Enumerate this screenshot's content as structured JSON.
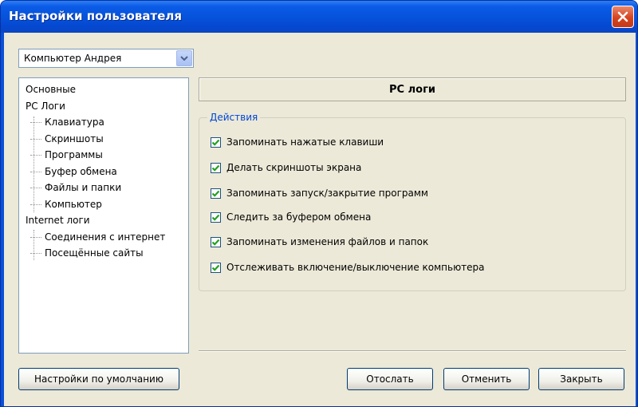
{
  "window": {
    "title": "Настройки пользователя"
  },
  "user_combo": {
    "value": "Компьютер Андрея"
  },
  "tree": {
    "items": [
      {
        "label": "Основные",
        "level": 0
      },
      {
        "label": "PC Логи",
        "level": 0
      },
      {
        "label": "Клавиатура",
        "level": 1
      },
      {
        "label": "Скриншоты",
        "level": 1
      },
      {
        "label": "Программы",
        "level": 1
      },
      {
        "label": "Буфер обмена",
        "level": 1
      },
      {
        "label": "Файлы и папки",
        "level": 1
      },
      {
        "label": "Компьютер",
        "level": 1
      },
      {
        "label": "Internet логи",
        "level": 0
      },
      {
        "label": "Соединения с интернет",
        "level": 1
      },
      {
        "label": "Посещённые сайты",
        "level": 1
      }
    ]
  },
  "panel": {
    "header": "PC логи",
    "group_title": "Действия",
    "checkboxes": [
      {
        "label": "Запоминать нажатые клавиши",
        "checked": true
      },
      {
        "label": "Делать скриншоты экрана",
        "checked": true
      },
      {
        "label": "Запоминать запуск/закрытие программ",
        "checked": true
      },
      {
        "label": "Следить за буфером обмена",
        "checked": true
      },
      {
        "label": "Запоминать изменения файлов и папок",
        "checked": true
      },
      {
        "label": "Отслеживать включение/выключение компьютера",
        "checked": true
      }
    ]
  },
  "buttons": {
    "defaults": "Настройки по умолчанию",
    "send": "Отослать",
    "cancel": "Отменить",
    "close": "Закрыть"
  },
  "colors": {
    "titlebar": "#0653dc",
    "dialog_bg": "#ece9d8",
    "group_title": "#0046d5",
    "close_button": "#d6431f",
    "checkmark": "#21a121"
  }
}
